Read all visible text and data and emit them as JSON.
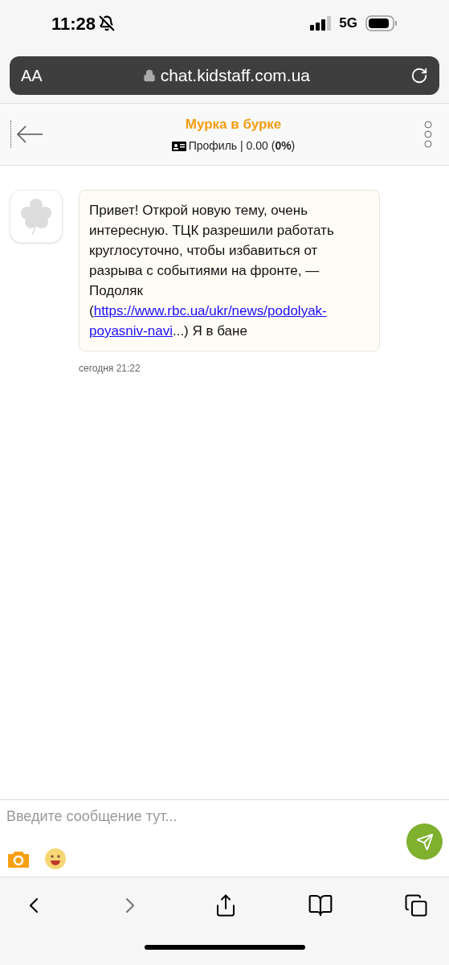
{
  "status_bar": {
    "time": "11:28",
    "network": "5G"
  },
  "address_bar": {
    "text_size": "AA",
    "url": "chat.kidstaff.com.ua"
  },
  "chat_header": {
    "title": "Мурка в бурке",
    "profile": "Профиль",
    "stats": " | 0.00 (",
    "percent": "0%",
    "stats_end": ")"
  },
  "messages": [
    {
      "text_before": "Привет! Открой новую тему, очень интересную. ТЦК разрешили работать круглосуточно, чтобы избавиться от разрыва с событиями на фронте, — Подоляк (",
      "link_parts": [
        "https://www.rbc.ua/ukr/news/podolyak-",
        "poyasniv-navi"
      ],
      "text_after": "...) Я в бане",
      "time": "сегодня 21:22"
    }
  ],
  "composer": {
    "placeholder": "Введите сообщение тут..."
  }
}
